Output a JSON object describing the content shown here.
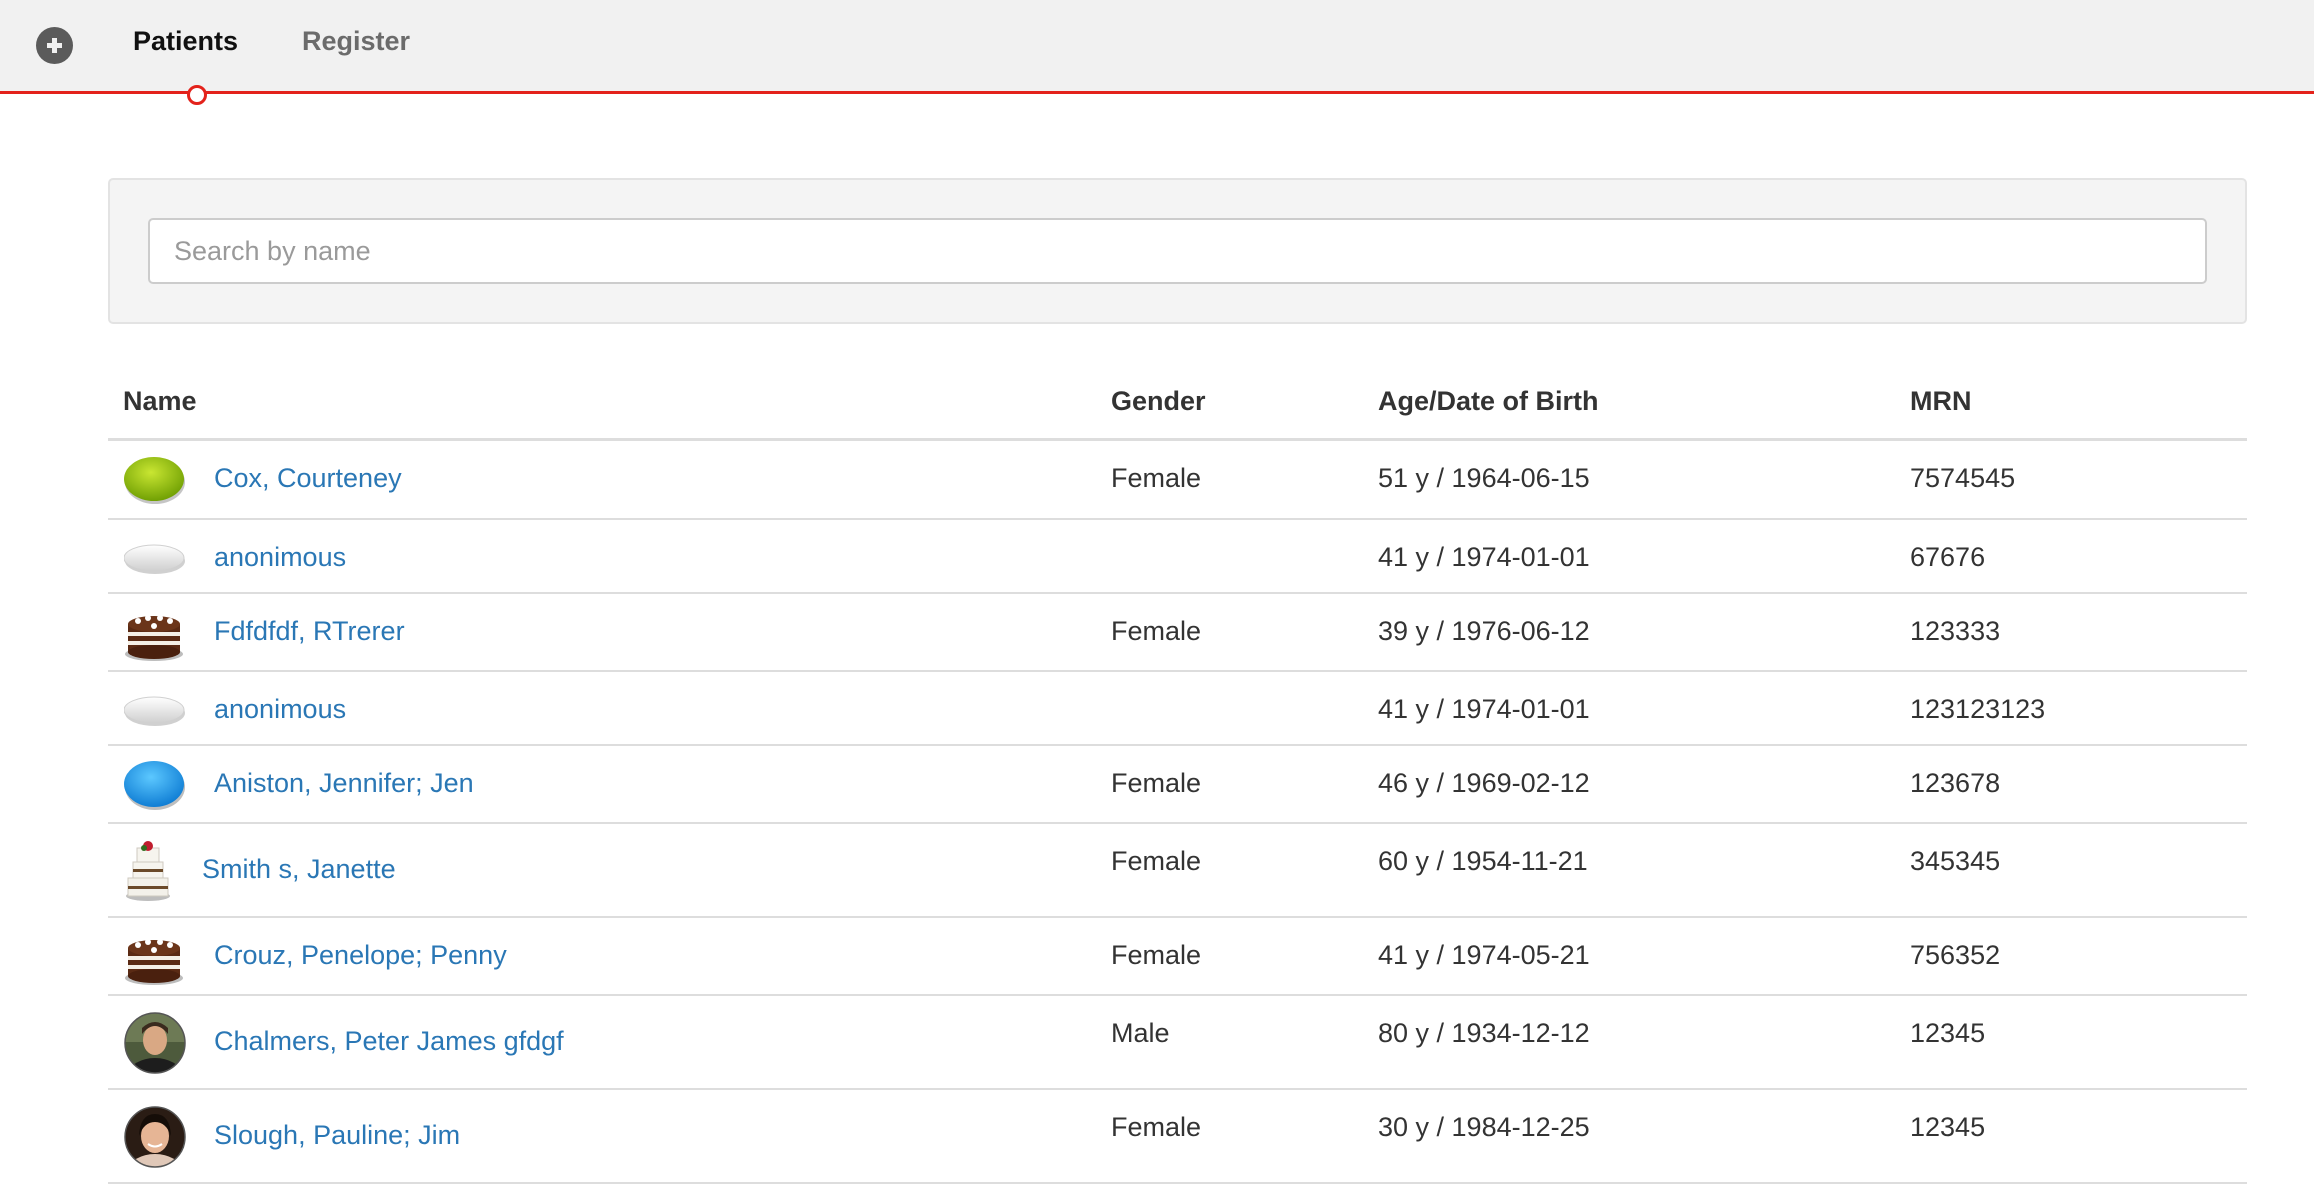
{
  "nav": {
    "add_icon": "plus-circle-icon",
    "tabs": [
      {
        "label": "Patients",
        "active": true
      },
      {
        "label": "Register",
        "active": false
      }
    ],
    "accent_color": "#e3221b"
  },
  "search": {
    "placeholder": "Search by name",
    "value": ""
  },
  "table": {
    "headers": {
      "name": "Name",
      "gender": "Gender",
      "dob": "Age/Date of Birth",
      "mrn": "MRN"
    },
    "rows": [
      {
        "avatar": "green-pill-avatar",
        "name": "Cox, Courteney",
        "gender": "Female",
        "dob": "51 y / 1964-06-15",
        "mrn": "7574545"
      },
      {
        "avatar": "white-pill-avatar",
        "name": "anonimous",
        "gender": "",
        "dob": "41 y / 1974-01-01",
        "mrn": "67676"
      },
      {
        "avatar": "chocolate-cake-avatar",
        "name": "Fdfdfdf, RTrerer",
        "gender": "Female",
        "dob": "39 y / 1976-06-12",
        "mrn": "123333"
      },
      {
        "avatar": "white-pill-avatar",
        "name": "anonimous",
        "gender": "",
        "dob": "41 y / 1974-01-01",
        "mrn": "123123123"
      },
      {
        "avatar": "blue-pill-avatar",
        "name": "Aniston, Jennifer; Jen",
        "gender": "Female",
        "dob": "46 y / 1969-02-12",
        "mrn": "123678"
      },
      {
        "avatar": "tiered-cake-avatar",
        "name": "Smith s, Janette",
        "gender": "Female",
        "dob": "60 y / 1954-11-21",
        "mrn": "345345"
      },
      {
        "avatar": "chocolate-cake-avatar",
        "name": "Crouz, Penelope; Penny",
        "gender": "Female",
        "dob": "41 y / 1974-05-21",
        "mrn": "756352"
      },
      {
        "avatar": "man-photo-avatar",
        "name": "Chalmers, Peter James gfdgf",
        "gender": "Male",
        "dob": "80 y / 1934-12-12",
        "mrn": "12345"
      },
      {
        "avatar": "woman-photo-avatar",
        "name": "Slough, Pauline; Jim",
        "gender": "Female",
        "dob": "30 y / 1984-12-25",
        "mrn": "12345"
      }
    ]
  }
}
